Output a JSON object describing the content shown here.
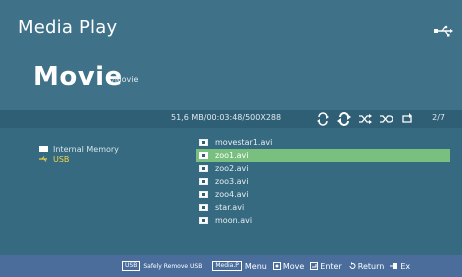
{
  "header": {
    "app_title": "Media Play",
    "section_title": "Movie",
    "section_path": "/Movie"
  },
  "info_bar": {
    "info": "51,6 MB/00:03:48/500X288",
    "page": "2/7",
    "mode_icons": [
      "repeat-one-icon",
      "repeat-all-icon",
      "shuffle-icon",
      "shuffle-repeat-icon",
      "repeat-off-icon"
    ]
  },
  "sources": [
    {
      "label": "Internal Memory",
      "icon": "memory-icon",
      "color": "#d9e6ec"
    },
    {
      "label": "USB",
      "icon": "usb-icon",
      "color": "#f3d54a"
    }
  ],
  "files": [
    {
      "name": "movestar1.avi",
      "selected": false
    },
    {
      "name": "zoo1.avi",
      "selected": true
    },
    {
      "name": "zoo2.avi",
      "selected": false
    },
    {
      "name": "zoo3.avi",
      "selected": false
    },
    {
      "name": "zoo4.avi",
      "selected": false
    },
    {
      "name": "star.avi",
      "selected": false
    },
    {
      "name": "moon.avi",
      "selected": false
    }
  ],
  "footer": {
    "safely_key": "USB",
    "safely_label": "Safely Remove USB",
    "menu_key": "Media.P",
    "menu_label": "Menu",
    "move_label": "Move",
    "enter_label": "Enter",
    "return_label": "Return",
    "exit_label": "Ex"
  },
  "colors": {
    "background": "#3f7289",
    "selection": "#79bf7f",
    "usb_highlight": "#f3d54a",
    "footer": "#4a6d9c"
  }
}
